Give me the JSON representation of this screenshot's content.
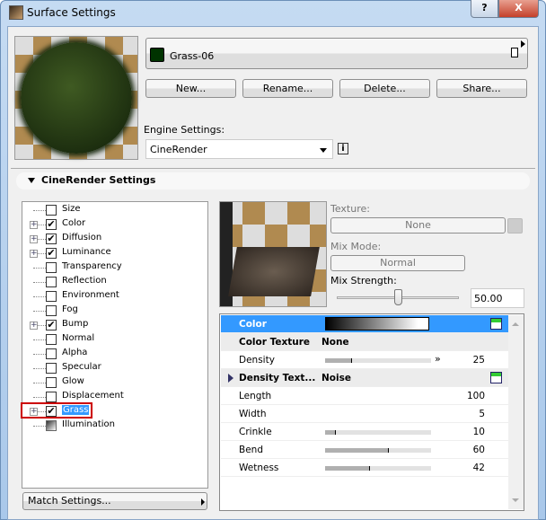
{
  "window": {
    "title": "Surface Settings",
    "help_label": "?",
    "close_label": "X"
  },
  "surface": {
    "name": "Grass-06",
    "swatch_color": "#003300"
  },
  "buttons": {
    "new": "New...",
    "rename": "Rename...",
    "delete": "Delete...",
    "share": "Share..."
  },
  "engine": {
    "label": "Engine Settings:",
    "value": "CineRender",
    "info": "i"
  },
  "section": {
    "title": "CineRender Settings"
  },
  "channels": [
    {
      "label": "Size",
      "checked": false,
      "expandable": false
    },
    {
      "label": "Color",
      "checked": true,
      "expandable": true
    },
    {
      "label": "Diffusion",
      "checked": true,
      "expandable": true
    },
    {
      "label": "Luminance",
      "checked": true,
      "expandable": true
    },
    {
      "label": "Transparency",
      "checked": false,
      "expandable": false
    },
    {
      "label": "Reflection",
      "checked": false,
      "expandable": false
    },
    {
      "label": "Environment",
      "checked": false,
      "expandable": false
    },
    {
      "label": "Fog",
      "checked": false,
      "expandable": false
    },
    {
      "label": "Bump",
      "checked": true,
      "expandable": true
    },
    {
      "label": "Normal",
      "checked": false,
      "expandable": false
    },
    {
      "label": "Alpha",
      "checked": false,
      "expandable": false
    },
    {
      "label": "Specular",
      "checked": false,
      "expandable": false
    },
    {
      "label": "Glow",
      "checked": false,
      "expandable": false
    },
    {
      "label": "Displacement",
      "checked": false,
      "expandable": false
    },
    {
      "label": "Grass",
      "checked": true,
      "expandable": true,
      "selected": true
    },
    {
      "label": "Illumination",
      "checked": false,
      "expandable": false
    }
  ],
  "match_settings": "Match Settings...",
  "texture": {
    "label": "Texture:",
    "value": "None",
    "mix_mode_label": "Mix Mode:",
    "mix_mode": "Normal",
    "mix_strength_label": "Mix Strength:",
    "mix_strength": "50.00",
    "mix_strength_fraction": 0.5
  },
  "properties": [
    {
      "key": "Color",
      "type": "gradient",
      "header": true
    },
    {
      "key": "Color Texture",
      "value": "None",
      "bold": true
    },
    {
      "key": "Density",
      "value": "25",
      "slider": 0.25
    },
    {
      "key": "Density Text...",
      "value": "Noise",
      "bold": true,
      "expander": true
    },
    {
      "key": "Length",
      "value": "100"
    },
    {
      "key": "Width",
      "value": "5"
    },
    {
      "key": "Crinkle",
      "value": "10",
      "slider": 0.1
    },
    {
      "key": "Bend",
      "value": "60",
      "slider": 0.6
    },
    {
      "key": "Wetness",
      "value": "42",
      "slider": 0.42
    }
  ]
}
